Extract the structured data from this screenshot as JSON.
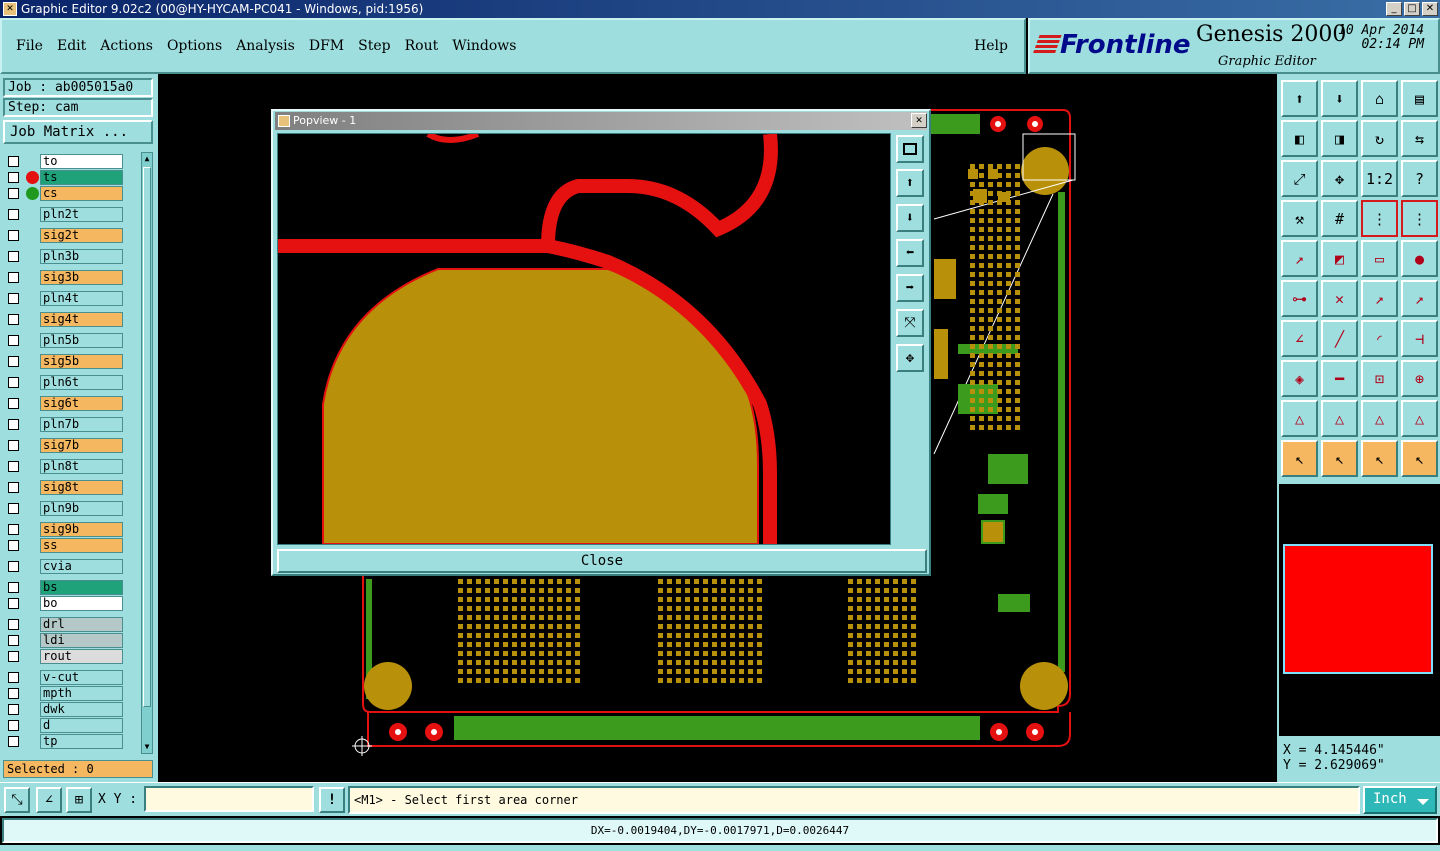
{
  "window": {
    "title": "Graphic Editor 9.02c2 (00@HY-HYCAM-PC041 - Windows, pid:1956)",
    "minimize": "_",
    "maximize": "□",
    "close": "✕"
  },
  "menu": {
    "items": [
      "File",
      "Edit",
      "Actions",
      "Options",
      "Analysis",
      "DFM",
      "Step",
      "Rout",
      "Windows"
    ],
    "help": "Help"
  },
  "brand": {
    "logo": "Frontline",
    "product": "Genesis 2000",
    "subtitle": "Graphic Editor",
    "date": "10 Apr 2014",
    "time": "02:14 PM"
  },
  "job": {
    "job_label": "Job : ab005015a0",
    "step_label": "Step: cam",
    "matrix_button": "Job Matrix ..."
  },
  "layers": [
    {
      "name": "to",
      "color": "#ffffff",
      "dot": ""
    },
    {
      "name": "ts",
      "color": "#1fa27a",
      "dot": "#e51010"
    },
    {
      "name": "cs",
      "color": "#f5b860",
      "dot": "#1f9a1f"
    },
    {
      "name": "pln2t",
      "color": "#9fdede",
      "dot": ""
    },
    {
      "name": "sig2t",
      "color": "#f5b860",
      "dot": ""
    },
    {
      "name": "pln3b",
      "color": "#9fdede",
      "dot": ""
    },
    {
      "name": "sig3b",
      "color": "#f5b860",
      "dot": ""
    },
    {
      "name": "pln4t",
      "color": "#9fdede",
      "dot": ""
    },
    {
      "name": "sig4t",
      "color": "#f5b860",
      "dot": ""
    },
    {
      "name": "pln5b",
      "color": "#9fdede",
      "dot": ""
    },
    {
      "name": "sig5b",
      "color": "#f5b860",
      "dot": ""
    },
    {
      "name": "pln6t",
      "color": "#9fdede",
      "dot": ""
    },
    {
      "name": "sig6t",
      "color": "#f5b860",
      "dot": ""
    },
    {
      "name": "pln7b",
      "color": "#9fdede",
      "dot": ""
    },
    {
      "name": "sig7b",
      "color": "#f5b860",
      "dot": ""
    },
    {
      "name": "pln8t",
      "color": "#9fdede",
      "dot": ""
    },
    {
      "name": "sig8t",
      "color": "#f5b860",
      "dot": ""
    },
    {
      "name": "pln9b",
      "color": "#9fdede",
      "dot": ""
    },
    {
      "name": "sig9b",
      "color": "#f5b860",
      "dot": ""
    },
    {
      "name": "ss",
      "color": "#f5b860",
      "dot": ""
    },
    {
      "name": "cvia",
      "color": "#9fdede",
      "dot": ""
    },
    {
      "name": "bs",
      "color": "#1fa27a",
      "dot": ""
    },
    {
      "name": "bo",
      "color": "#ffffff",
      "dot": ""
    },
    {
      "name": "drl",
      "color": "#b5c8c8",
      "dot": ""
    },
    {
      "name": "ldi",
      "color": "#b5c8c8",
      "dot": ""
    },
    {
      "name": "rout",
      "color": "#dcdcdc",
      "dot": ""
    },
    {
      "name": "v-cut",
      "color": "#9fdede",
      "dot": ""
    },
    {
      "name": "mpth",
      "color": "#9fdede",
      "dot": ""
    },
    {
      "name": "dwk",
      "color": "#9fdede",
      "dot": ""
    },
    {
      "name": "d",
      "color": "#9fdede",
      "dot": ""
    },
    {
      "name": "tp",
      "color": "#9fdede",
      "dot": ""
    }
  ],
  "selected": "Selected : 0",
  "popview": {
    "title": "Popview - 1",
    "close_x": "✕",
    "close_button": "Close"
  },
  "coords": {
    "x": "X = 4.145446\"",
    "y": "Y = 2.629069\""
  },
  "bottom": {
    "xy_label": "X Y :",
    "xy_value": "",
    "alert": "!",
    "prompt": "<M1> - Select first area corner",
    "unit": "Inch"
  },
  "status": "DX=-0.0019404,DY=-0.0017971,D=0.0026447",
  "colors": {
    "panel": "#9fdede",
    "copper": "#b8900a",
    "trace_red": "#e51010",
    "board_green": "#3c9a1c"
  }
}
